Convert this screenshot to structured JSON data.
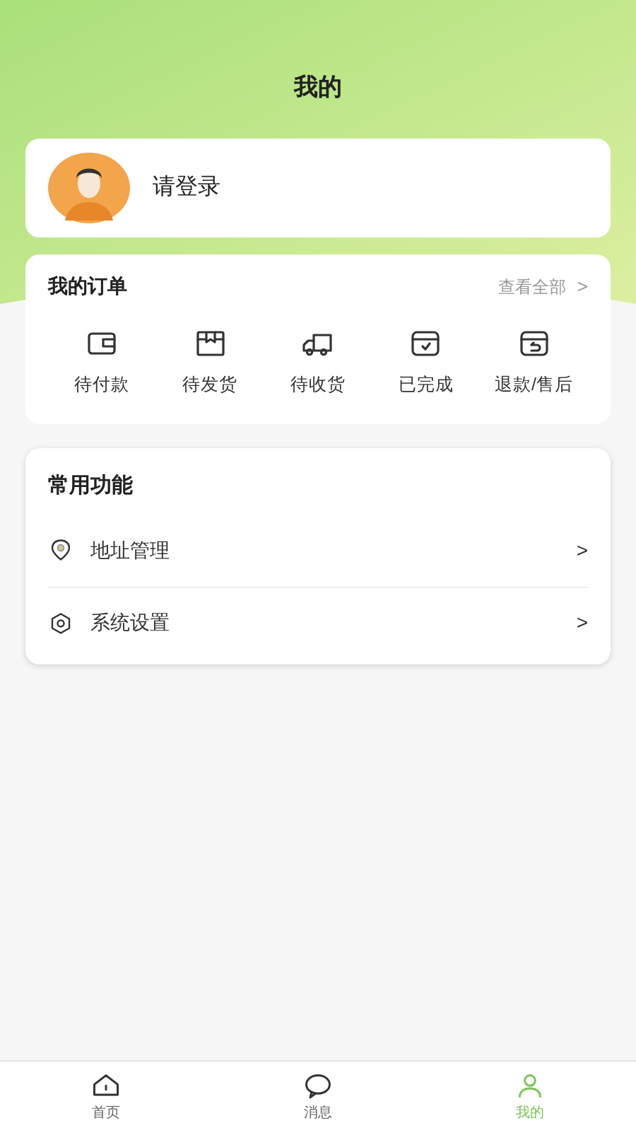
{
  "header": {
    "title": "我的"
  },
  "profile": {
    "login_label": "请登录"
  },
  "orders": {
    "title": "我的订单",
    "view_all": "查看全部",
    "view_all_arrow": ">",
    "items": [
      {
        "kind": "wallet",
        "label": "待付款"
      },
      {
        "kind": "box",
        "label": "待发货"
      },
      {
        "kind": "truck",
        "label": "待收货"
      },
      {
        "kind": "done",
        "label": "已完成"
      },
      {
        "kind": "refund",
        "label": "退款/售后"
      }
    ]
  },
  "functions": {
    "title": "常用功能",
    "items": [
      {
        "kind": "pin",
        "label": "地址管理",
        "arrow": ">"
      },
      {
        "kind": "gear",
        "label": "系统设置",
        "arrow": ">"
      }
    ]
  },
  "tab_bar": [
    {
      "kind": "home",
      "label": "首页",
      "selected": false
    },
    {
      "kind": "chat",
      "label": "消息",
      "selected": false
    },
    {
      "kind": "user",
      "label": "我的",
      "selected": true
    }
  ]
}
